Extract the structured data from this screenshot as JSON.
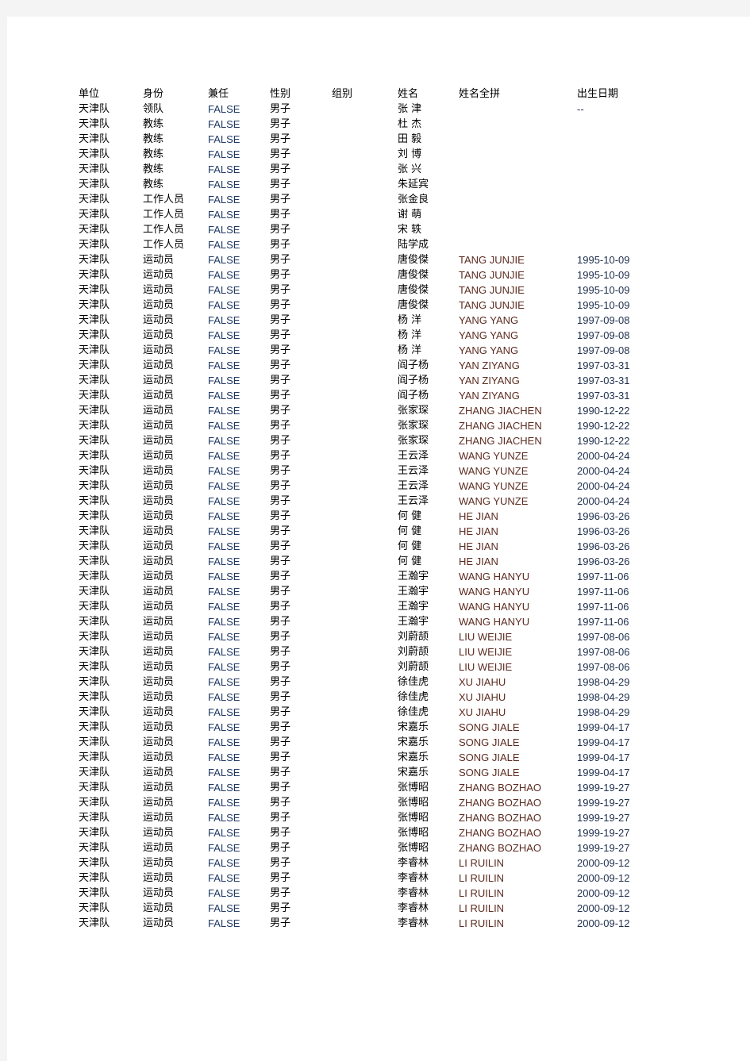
{
  "document": {
    "type": "spreadsheet-print-preview",
    "page_background": "#ffffff",
    "canvas_background": "#f4f4f4"
  },
  "table": {
    "headers": [
      "单位",
      "身份",
      "兼任",
      "性别",
      "组别",
      "姓名",
      "姓名全拼",
      "出生日期"
    ],
    "rows": [
      {
        "unit": "天津队",
        "role": "领队",
        "concurrent": "FALSE",
        "gender": "男子",
        "group": "",
        "name": "张 津",
        "pinyin": "",
        "birth": "--"
      },
      {
        "unit": "天津队",
        "role": "教练",
        "concurrent": "FALSE",
        "gender": "男子",
        "group": "",
        "name": "杜 杰",
        "pinyin": "",
        "birth": ""
      },
      {
        "unit": "天津队",
        "role": "教练",
        "concurrent": "FALSE",
        "gender": "男子",
        "group": "",
        "name": "田 毅",
        "pinyin": "",
        "birth": ""
      },
      {
        "unit": "天津队",
        "role": "教练",
        "concurrent": "FALSE",
        "gender": "男子",
        "group": "",
        "name": "刘 博",
        "pinyin": "",
        "birth": ""
      },
      {
        "unit": "天津队",
        "role": "教练",
        "concurrent": "FALSE",
        "gender": "男子",
        "group": "",
        "name": "张 兴",
        "pinyin": "",
        "birth": ""
      },
      {
        "unit": "天津队",
        "role": "教练",
        "concurrent": "FALSE",
        "gender": "男子",
        "group": "",
        "name": "朱延宾",
        "pinyin": "",
        "birth": ""
      },
      {
        "unit": "天津队",
        "role": "工作人员",
        "concurrent": "FALSE",
        "gender": "男子",
        "group": "",
        "name": "张金良",
        "pinyin": "",
        "birth": ""
      },
      {
        "unit": "天津队",
        "role": "工作人员",
        "concurrent": "FALSE",
        "gender": "男子",
        "group": "",
        "name": "谢 萌",
        "pinyin": "",
        "birth": ""
      },
      {
        "unit": "天津队",
        "role": "工作人员",
        "concurrent": "FALSE",
        "gender": "男子",
        "group": "",
        "name": "宋 轶",
        "pinyin": "",
        "birth": ""
      },
      {
        "unit": "天津队",
        "role": "工作人员",
        "concurrent": "FALSE",
        "gender": "男子",
        "group": "",
        "name": "陆学成",
        "pinyin": "",
        "birth": ""
      },
      {
        "unit": "天津队",
        "role": "运动员",
        "concurrent": "FALSE",
        "gender": "男子",
        "group": "",
        "name": "唐俊傑",
        "pinyin": "TANG JUNJIE",
        "birth": "1995-10-09"
      },
      {
        "unit": "天津队",
        "role": "运动员",
        "concurrent": "FALSE",
        "gender": "男子",
        "group": "",
        "name": "唐俊傑",
        "pinyin": "TANG JUNJIE",
        "birth": "1995-10-09"
      },
      {
        "unit": "天津队",
        "role": "运动员",
        "concurrent": "FALSE",
        "gender": "男子",
        "group": "",
        "name": "唐俊傑",
        "pinyin": "TANG JUNJIE",
        "birth": "1995-10-09"
      },
      {
        "unit": "天津队",
        "role": "运动员",
        "concurrent": "FALSE",
        "gender": "男子",
        "group": "",
        "name": "唐俊傑",
        "pinyin": "TANG JUNJIE",
        "birth": "1995-10-09"
      },
      {
        "unit": "天津队",
        "role": "运动员",
        "concurrent": "FALSE",
        "gender": "男子",
        "group": "",
        "name": "杨 洋",
        "pinyin": "YANG YANG",
        "birth": "1997-09-08"
      },
      {
        "unit": "天津队",
        "role": "运动员",
        "concurrent": "FALSE",
        "gender": "男子",
        "group": "",
        "name": "杨 洋",
        "pinyin": "YANG YANG",
        "birth": "1997-09-08"
      },
      {
        "unit": "天津队",
        "role": "运动员",
        "concurrent": "FALSE",
        "gender": "男子",
        "group": "",
        "name": "杨 洋",
        "pinyin": "YANG YANG",
        "birth": "1997-09-08"
      },
      {
        "unit": "天津队",
        "role": "运动员",
        "concurrent": "FALSE",
        "gender": "男子",
        "group": "",
        "name": "阎子杨",
        "pinyin": "YAN ZIYANG",
        "birth": "1997-03-31"
      },
      {
        "unit": "天津队",
        "role": "运动员",
        "concurrent": "FALSE",
        "gender": "男子",
        "group": "",
        "name": "阎子杨",
        "pinyin": "YAN ZIYANG",
        "birth": "1997-03-31"
      },
      {
        "unit": "天津队",
        "role": "运动员",
        "concurrent": "FALSE",
        "gender": "男子",
        "group": "",
        "name": "阎子杨",
        "pinyin": "YAN ZIYANG",
        "birth": "1997-03-31"
      },
      {
        "unit": "天津队",
        "role": "运动员",
        "concurrent": "FALSE",
        "gender": "男子",
        "group": "",
        "name": "张家琛",
        "pinyin": "ZHANG JIACHEN",
        "birth": "1990-12-22"
      },
      {
        "unit": "天津队",
        "role": "运动员",
        "concurrent": "FALSE",
        "gender": "男子",
        "group": "",
        "name": "张家琛",
        "pinyin": "ZHANG JIACHEN",
        "birth": "1990-12-22"
      },
      {
        "unit": "天津队",
        "role": "运动员",
        "concurrent": "FALSE",
        "gender": "男子",
        "group": "",
        "name": "张家琛",
        "pinyin": "ZHANG JIACHEN",
        "birth": "1990-12-22"
      },
      {
        "unit": "天津队",
        "role": "运动员",
        "concurrent": "FALSE",
        "gender": "男子",
        "group": "",
        "name": "王云泽",
        "pinyin": "WANG YUNZE",
        "birth": "2000-04-24"
      },
      {
        "unit": "天津队",
        "role": "运动员",
        "concurrent": "FALSE",
        "gender": "男子",
        "group": "",
        "name": "王云泽",
        "pinyin": "WANG YUNZE",
        "birth": "2000-04-24"
      },
      {
        "unit": "天津队",
        "role": "运动员",
        "concurrent": "FALSE",
        "gender": "男子",
        "group": "",
        "name": "王云泽",
        "pinyin": "WANG YUNZE",
        "birth": "2000-04-24"
      },
      {
        "unit": "天津队",
        "role": "运动员",
        "concurrent": "FALSE",
        "gender": "男子",
        "group": "",
        "name": "王云泽",
        "pinyin": "WANG YUNZE",
        "birth": "2000-04-24"
      },
      {
        "unit": "天津队",
        "role": "运动员",
        "concurrent": "FALSE",
        "gender": "男子",
        "group": "",
        "name": "何 健",
        "pinyin": "HE JIAN",
        "birth": "1996-03-26"
      },
      {
        "unit": "天津队",
        "role": "运动员",
        "concurrent": "FALSE",
        "gender": "男子",
        "group": "",
        "name": "何 健",
        "pinyin": "HE JIAN",
        "birth": "1996-03-26"
      },
      {
        "unit": "天津队",
        "role": "运动员",
        "concurrent": "FALSE",
        "gender": "男子",
        "group": "",
        "name": "何 健",
        "pinyin": "HE JIAN",
        "birth": "1996-03-26"
      },
      {
        "unit": "天津队",
        "role": "运动员",
        "concurrent": "FALSE",
        "gender": "男子",
        "group": "",
        "name": "何 健",
        "pinyin": "HE JIAN",
        "birth": "1996-03-26"
      },
      {
        "unit": "天津队",
        "role": "运动员",
        "concurrent": "FALSE",
        "gender": "男子",
        "group": "",
        "name": "王瀚宇",
        "pinyin": "WANG HANYU",
        "birth": "1997-11-06"
      },
      {
        "unit": "天津队",
        "role": "运动员",
        "concurrent": "FALSE",
        "gender": "男子",
        "group": "",
        "name": "王瀚宇",
        "pinyin": "WANG HANYU",
        "birth": "1997-11-06"
      },
      {
        "unit": "天津队",
        "role": "运动员",
        "concurrent": "FALSE",
        "gender": "男子",
        "group": "",
        "name": "王瀚宇",
        "pinyin": "WANG HANYU",
        "birth": "1997-11-06"
      },
      {
        "unit": "天津队",
        "role": "运动员",
        "concurrent": "FALSE",
        "gender": "男子",
        "group": "",
        "name": "王瀚宇",
        "pinyin": "WANG HANYU",
        "birth": "1997-11-06"
      },
      {
        "unit": "天津队",
        "role": "运动员",
        "concurrent": "FALSE",
        "gender": "男子",
        "group": "",
        "name": "刘蔚颉",
        "pinyin": "LIU WEIJIE",
        "birth": "1997-08-06"
      },
      {
        "unit": "天津队",
        "role": "运动员",
        "concurrent": "FALSE",
        "gender": "男子",
        "group": "",
        "name": "刘蔚颉",
        "pinyin": "LIU WEIJIE",
        "birth": "1997-08-06"
      },
      {
        "unit": "天津队",
        "role": "运动员",
        "concurrent": "FALSE",
        "gender": "男子",
        "group": "",
        "name": "刘蔚颉",
        "pinyin": "LIU WEIJIE",
        "birth": "1997-08-06"
      },
      {
        "unit": "天津队",
        "role": "运动员",
        "concurrent": "FALSE",
        "gender": "男子",
        "group": "",
        "name": "徐佳虎",
        "pinyin": "XU JIAHU",
        "birth": "1998-04-29"
      },
      {
        "unit": "天津队",
        "role": "运动员",
        "concurrent": "FALSE",
        "gender": "男子",
        "group": "",
        "name": "徐佳虎",
        "pinyin": "XU JIAHU",
        "birth": "1998-04-29"
      },
      {
        "unit": "天津队",
        "role": "运动员",
        "concurrent": "FALSE",
        "gender": "男子",
        "group": "",
        "name": "徐佳虎",
        "pinyin": "XU JIAHU",
        "birth": "1998-04-29"
      },
      {
        "unit": "天津队",
        "role": "运动员",
        "concurrent": "FALSE",
        "gender": "男子",
        "group": "",
        "name": "宋嘉乐",
        "pinyin": "SONG JIALE",
        "birth": "1999-04-17"
      },
      {
        "unit": "天津队",
        "role": "运动员",
        "concurrent": "FALSE",
        "gender": "男子",
        "group": "",
        "name": "宋嘉乐",
        "pinyin": "SONG JIALE",
        "birth": "1999-04-17"
      },
      {
        "unit": "天津队",
        "role": "运动员",
        "concurrent": "FALSE",
        "gender": "男子",
        "group": "",
        "name": "宋嘉乐",
        "pinyin": "SONG JIALE",
        "birth": "1999-04-17"
      },
      {
        "unit": "天津队",
        "role": "运动员",
        "concurrent": "FALSE",
        "gender": "男子",
        "group": "",
        "name": "宋嘉乐",
        "pinyin": "SONG JIALE",
        "birth": "1999-04-17"
      },
      {
        "unit": "天津队",
        "role": "运动员",
        "concurrent": "FALSE",
        "gender": "男子",
        "group": "",
        "name": "张博昭",
        "pinyin": "ZHANG BOZHAO",
        "birth": "1999-19-27"
      },
      {
        "unit": "天津队",
        "role": "运动员",
        "concurrent": "FALSE",
        "gender": "男子",
        "group": "",
        "name": "张博昭",
        "pinyin": "ZHANG BOZHAO",
        "birth": "1999-19-27"
      },
      {
        "unit": "天津队",
        "role": "运动员",
        "concurrent": "FALSE",
        "gender": "男子",
        "group": "",
        "name": "张博昭",
        "pinyin": "ZHANG BOZHAO",
        "birth": "1999-19-27"
      },
      {
        "unit": "天津队",
        "role": "运动员",
        "concurrent": "FALSE",
        "gender": "男子",
        "group": "",
        "name": "张博昭",
        "pinyin": "ZHANG BOZHAO",
        "birth": "1999-19-27"
      },
      {
        "unit": "天津队",
        "role": "运动员",
        "concurrent": "FALSE",
        "gender": "男子",
        "group": "",
        "name": "张博昭",
        "pinyin": "ZHANG BOZHAO",
        "birth": "1999-19-27"
      },
      {
        "unit": "天津队",
        "role": "运动员",
        "concurrent": "FALSE",
        "gender": "男子",
        "group": "",
        "name": "李睿林",
        "pinyin": "LI RUILIN",
        "birth": "2000-09-12"
      },
      {
        "unit": "天津队",
        "role": "运动员",
        "concurrent": "FALSE",
        "gender": "男子",
        "group": "",
        "name": "李睿林",
        "pinyin": "LI RUILIN",
        "birth": "2000-09-12"
      },
      {
        "unit": "天津队",
        "role": "运动员",
        "concurrent": "FALSE",
        "gender": "男子",
        "group": "",
        "name": "李睿林",
        "pinyin": "LI RUILIN",
        "birth": "2000-09-12"
      },
      {
        "unit": "天津队",
        "role": "运动员",
        "concurrent": "FALSE",
        "gender": "男子",
        "group": "",
        "name": "李睿林",
        "pinyin": "LI RUILIN",
        "birth": "2000-09-12"
      },
      {
        "unit": "天津队",
        "role": "运动员",
        "concurrent": "FALSE",
        "gender": "男子",
        "group": "",
        "name": "李睿林",
        "pinyin": "LI RUILIN",
        "birth": "2000-09-12"
      }
    ]
  },
  "colors": {
    "concurrent_ink": "#1f3864",
    "pinyin_ink": "#5b2b20",
    "birth_ink": "#1f2f4d",
    "default_ink": "#000000"
  }
}
